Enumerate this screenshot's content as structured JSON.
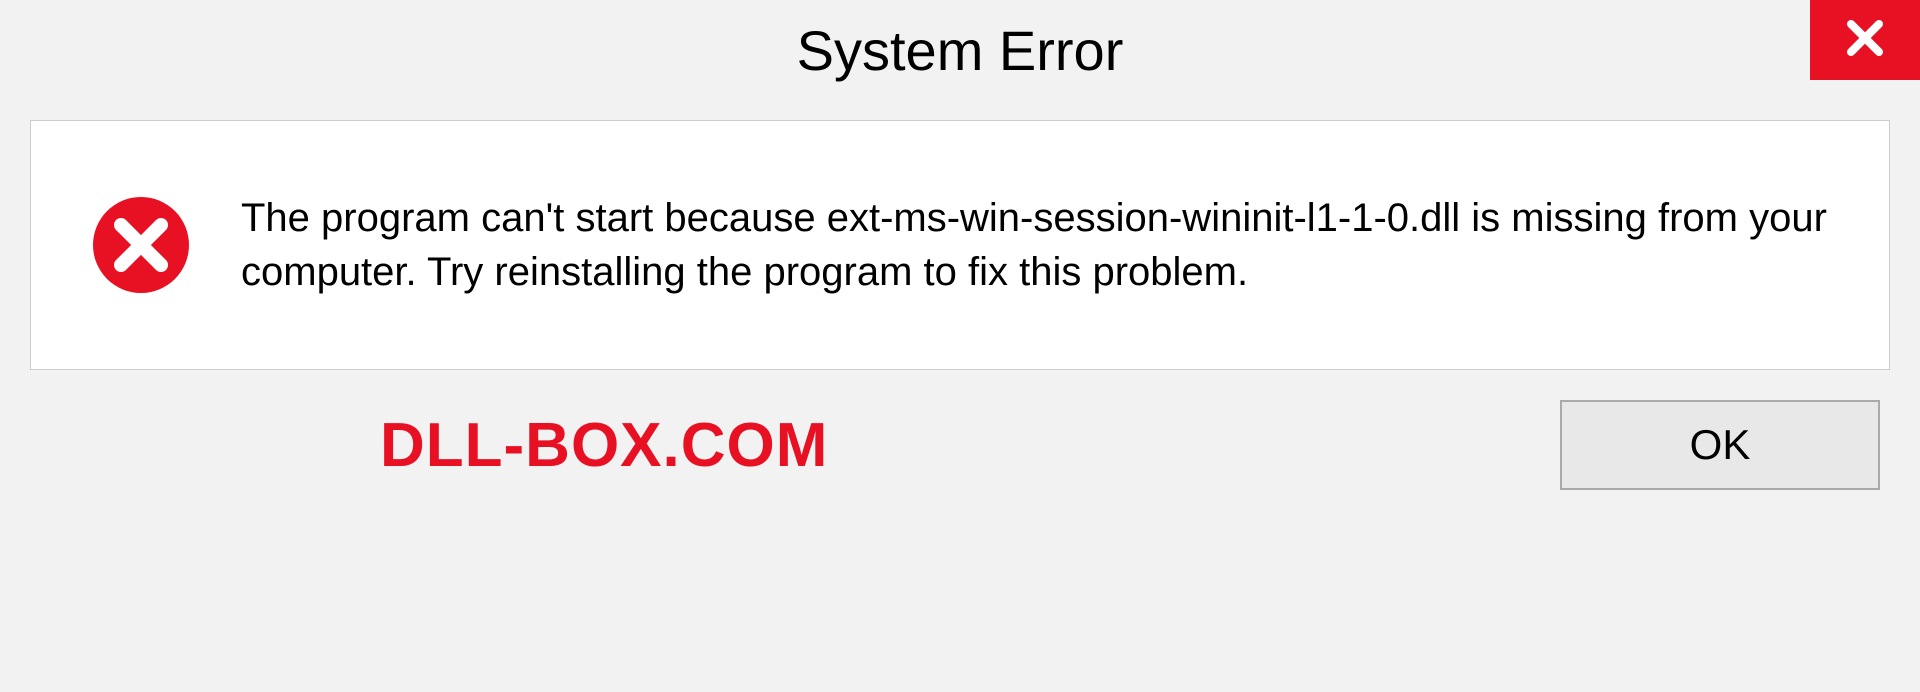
{
  "dialog": {
    "title": "System Error",
    "message": "The program can't start because ext-ms-win-session-wininit-l1-1-0.dll is missing from your computer. Try reinstalling the program to fix this problem.",
    "ok_label": "OK"
  },
  "watermark": "DLL-BOX.COM"
}
